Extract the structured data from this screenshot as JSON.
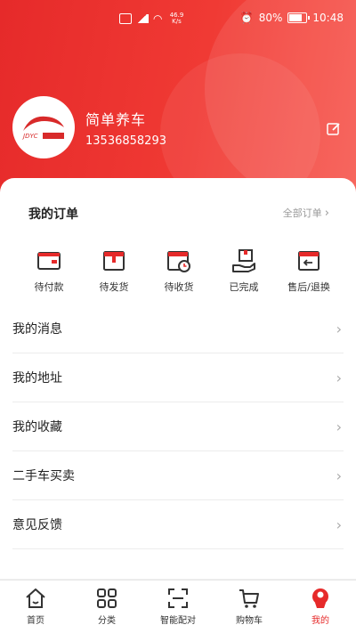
{
  "status_bar": {
    "speed": "46.9 K/s",
    "battery": "80%",
    "time": "10:48"
  },
  "profile": {
    "name": "简单养车",
    "phone": "13536858293"
  },
  "orders": {
    "title": "我的订单",
    "all_label": "全部订单",
    "items": [
      {
        "label": "待付款",
        "icon": "wallet-icon"
      },
      {
        "label": "待发货",
        "icon": "package-icon"
      },
      {
        "label": "待收货",
        "icon": "calendar-clock-icon"
      },
      {
        "label": "已完成",
        "icon": "hand-box-icon"
      },
      {
        "label": "售后/退换",
        "icon": "return-box-icon"
      }
    ]
  },
  "menu": [
    {
      "label": "我的消息"
    },
    {
      "label": "我的地址"
    },
    {
      "label": "我的收藏"
    },
    {
      "label": "二手车买卖"
    },
    {
      "label": "意见反馈"
    }
  ],
  "nav": [
    {
      "label": "首页",
      "icon": "home-icon"
    },
    {
      "label": "分类",
      "icon": "grid-icon"
    },
    {
      "label": "智能配对",
      "icon": "scan-icon"
    },
    {
      "label": "购物车",
      "icon": "cart-icon"
    },
    {
      "label": "我的",
      "icon": "user-icon",
      "active": true
    }
  ],
  "colors": {
    "accent": "#e62a2a"
  }
}
